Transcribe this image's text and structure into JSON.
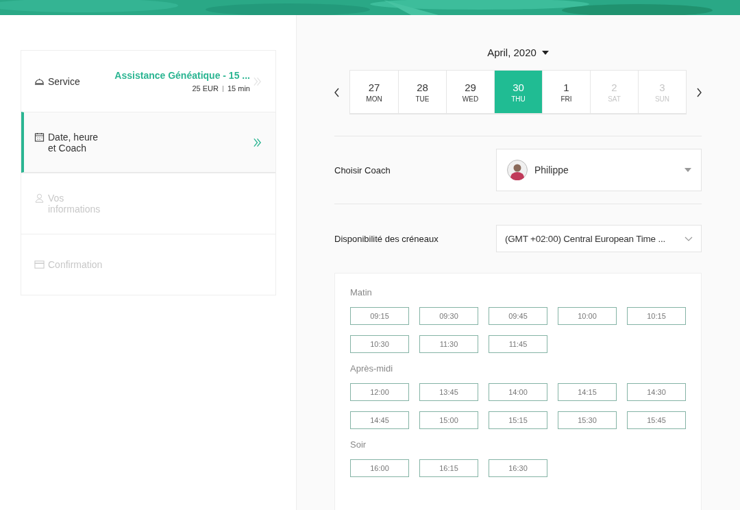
{
  "steps": [
    {
      "kind": "service",
      "label": "Service",
      "value": "Assistance Généatique - 15 ...",
      "price": "25 EUR",
      "duration": "15 min",
      "active": false,
      "disabled": false
    },
    {
      "kind": "calendar",
      "label": "Date, heure et Coach",
      "active": true,
      "disabled": false
    },
    {
      "kind": "person",
      "label": "Vos informations",
      "active": false,
      "disabled": true
    },
    {
      "kind": "card",
      "label": "Confirmation",
      "active": false,
      "disabled": true
    }
  ],
  "month": "April, 2020",
  "days": [
    {
      "day": "27",
      "weekday": "MON",
      "selected": false,
      "disabled": false
    },
    {
      "day": "28",
      "weekday": "TUE",
      "selected": false,
      "disabled": false
    },
    {
      "day": "29",
      "weekday": "WED",
      "selected": false,
      "disabled": false
    },
    {
      "day": "30",
      "weekday": "THU",
      "selected": true,
      "disabled": false
    },
    {
      "day": "1",
      "weekday": "FRI",
      "selected": false,
      "disabled": false
    },
    {
      "day": "2",
      "weekday": "SAT",
      "selected": false,
      "disabled": true
    },
    {
      "day": "3",
      "weekday": "SUN",
      "selected": false,
      "disabled": true
    }
  ],
  "coach": {
    "label": "Choisir Coach",
    "value": "Philippe"
  },
  "timezone": {
    "label": "Disponibilité des créneaux",
    "value": "(GMT +02:00) Central European Time ..."
  },
  "slot_groups": [
    {
      "title": "Matin",
      "slots": [
        "09:15",
        "09:30",
        "09:45",
        "10:00",
        "10:15",
        "10:30",
        "11:30",
        "11:45"
      ]
    },
    {
      "title": "Après-midi",
      "slots": [
        "12:00",
        "13:45",
        "14:00",
        "14:15",
        "14:30",
        "14:45",
        "15:00",
        "15:15",
        "15:30",
        "15:45"
      ]
    },
    {
      "title": "Soir",
      "slots": [
        "16:00",
        "16:15",
        "16:30"
      ]
    }
  ]
}
